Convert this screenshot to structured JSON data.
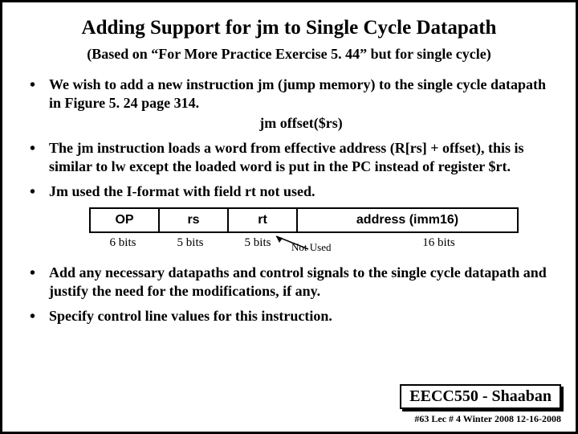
{
  "title": "Adding Support for jm to Single Cycle Datapath",
  "subtitle": "(Based on “For More Practice Exercise 5. 44” but for single cycle)",
  "bullets": {
    "b1": "We wish to add  a new instruction jm (jump memory)  to the single cycle datapath in Figure 5. 24 page 314.",
    "b1_sub": "jm   offset($rs)",
    "b2": "The jm instruction loads a word from effective address (R[rs] + offset), this is similar to lw except the loaded word is put in the PC instead of register $rt.",
    "b3": "Jm used the I-format with field  rt not used.",
    "b4": "Add any necessary datapaths and control signals to the single cycle datapath and justify the need for the modifications, if any.",
    "b5": "Specify control line values for this instruction."
  },
  "format": {
    "headers": {
      "op": "OP",
      "rs": "rs",
      "rt": "rt",
      "addr": "address (imm16)"
    },
    "widths": {
      "op": "6 bits",
      "rs": "5 bits",
      "rt": "5 bits",
      "addr": "16  bits"
    },
    "not_used": "Not Used"
  },
  "footer": {
    "tag": "EECC550 - Shaaban",
    "meta": "#63  Lec # 4   Winter 2008  12-16-2008"
  }
}
